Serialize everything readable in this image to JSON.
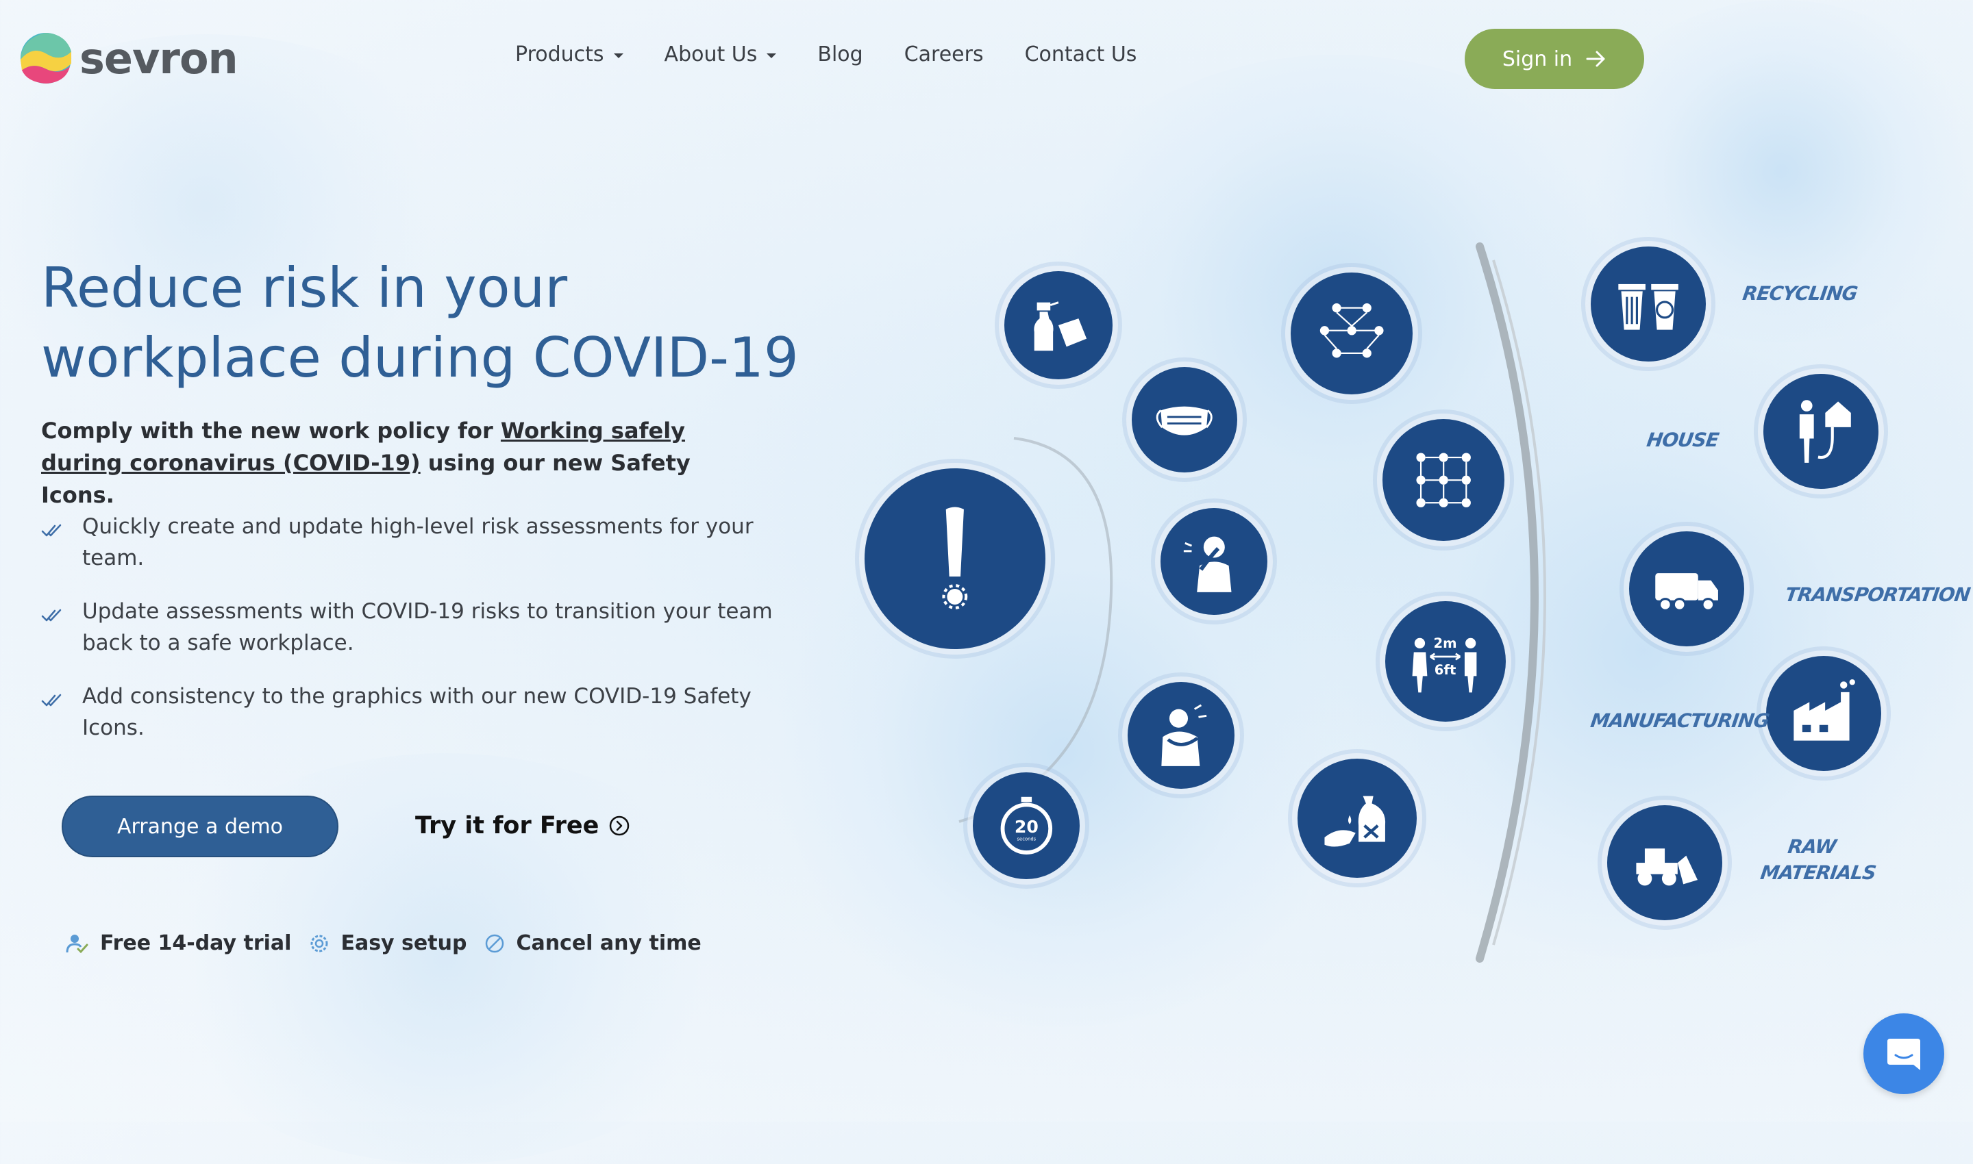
{
  "brand": {
    "name": "sevron"
  },
  "nav": {
    "items": [
      {
        "label": "Products",
        "dropdown": true
      },
      {
        "label": "About Us",
        "dropdown": true
      },
      {
        "label": "Blog",
        "dropdown": false
      },
      {
        "label": "Careers",
        "dropdown": false
      },
      {
        "label": "Contact Us",
        "dropdown": false
      }
    ],
    "signin_label": "Sign in"
  },
  "hero": {
    "title": "Reduce risk in your workplace during COVID-19",
    "subtitle_prefix": "Comply with the new work policy for ",
    "subtitle_link": "Working safely during coronavirus (COVID-19)",
    "subtitle_suffix": " using our new Safety Icons.",
    "features": [
      "Quickly create and update high-level risk assessments for your team.",
      "Update assessments with COVID-19 risks to transition your team back to a safe workplace.",
      "Add consistency to the graphics with our new COVID-19 Safety Icons."
    ],
    "demo_button": "Arrange a demo",
    "try_link": "Try it for Free",
    "perks": [
      "Free 14-day trial",
      "Easy setup",
      "Cancel any time"
    ]
  },
  "illustration": {
    "icons": [
      "warning-exclamation-icon",
      "cleaning-spray-icon",
      "face-mask-icon",
      "cough-icon",
      "self-isolation-icon",
      "hand-wash-timer-icon",
      "network-distance-icon",
      "group-distance-icon",
      "social-distance-icon",
      "hand-sanitizer-icon",
      "recycling-bins-icon",
      "house-power-icon",
      "truck-icon",
      "factory-icon",
      "bulldozer-icon"
    ],
    "timer_value": "20",
    "timer_unit": "seconds",
    "distance_top": "2m",
    "distance_bottom": "6ft",
    "labels": {
      "recycling": "RECYCLING",
      "house": "HOUSE",
      "transportation": "TRANSPORTATION",
      "manufacturing": "MANUFACTURING",
      "raw_materials_1": "RAW",
      "raw_materials_2": "MATERIALS"
    }
  },
  "colors": {
    "primary": "#2f5f95",
    "accent_green": "#8aab57",
    "icon_navy": "#1d4a85",
    "chat_blue": "#3c86e6"
  }
}
